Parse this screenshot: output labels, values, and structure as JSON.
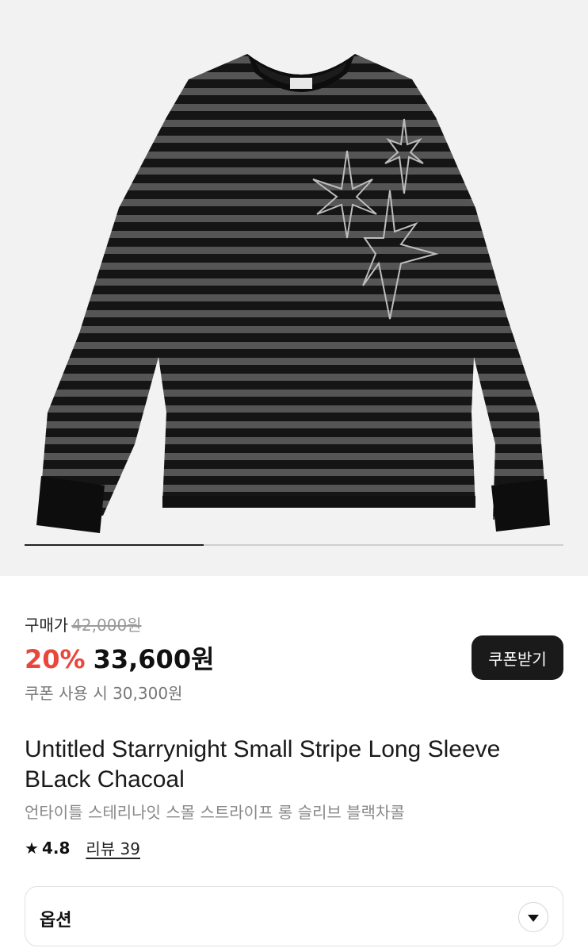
{
  "hero": {
    "image_alt": "Untitled Starrynight Small Stripe Long Sleeve - black/charcoal striped long-sleeve tee with star embroidery",
    "slide_progress": 0.333
  },
  "price": {
    "label": "구매가",
    "original": "42,000원",
    "discount": "20%",
    "current": "33,600원",
    "coupon_note": "쿠폰 사용 시 30,300원",
    "coupon_button": "쿠폰받기"
  },
  "product": {
    "title_en": "Untitled Starrynight Small Stripe Long Sleeve BLack Chacoal",
    "title_ko": "언타이틀 스테리나잇 스몰 스트라이프 롱 슬리브 블랙차콜",
    "rating": "4.8",
    "review_label": "리뷰 39"
  },
  "options": {
    "label": "옵션"
  },
  "colors": {
    "discount": "#e8473c",
    "button_bg": "#1a1a1a"
  }
}
